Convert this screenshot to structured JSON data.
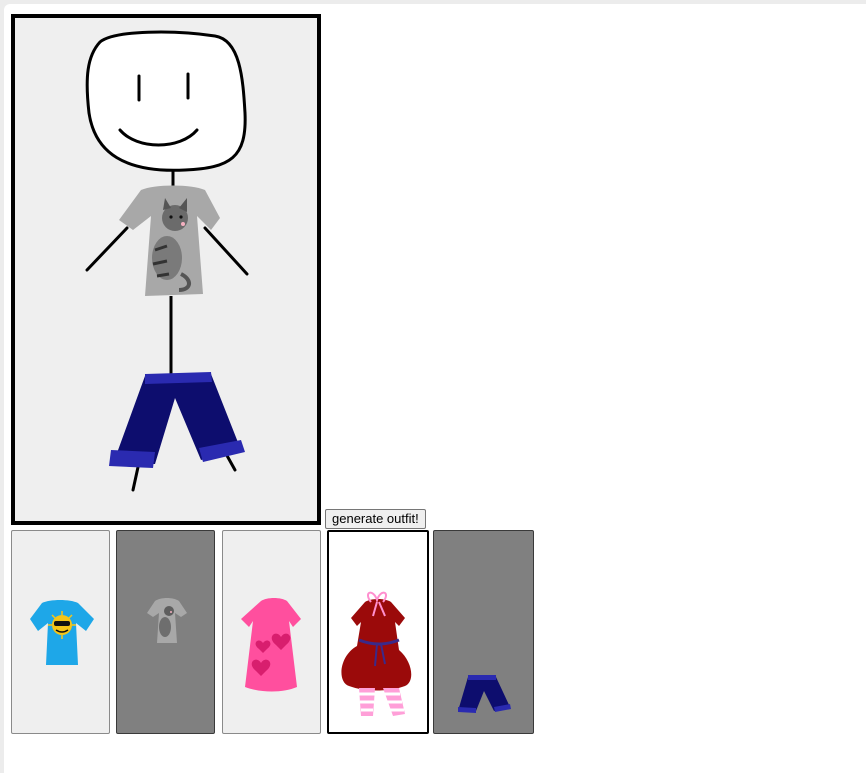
{
  "button": {
    "label": "generate outfit!"
  },
  "stage": {
    "figure": "stick-figure",
    "worn": [
      "cat-shirt",
      "blue-shorts"
    ]
  },
  "wardrobe": [
    {
      "name": "sun-shirt",
      "highlighted": false
    },
    {
      "name": "cat-shirt",
      "highlighted": false
    },
    {
      "name": "pink-heart-dress",
      "highlighted": false
    },
    {
      "name": "red-dress-striped-leggings",
      "highlighted": true
    },
    {
      "name": "blue-shorts",
      "highlighted": false
    }
  ],
  "colors": {
    "stage_bg": "#efefef",
    "selected_tile_bg": "#808080",
    "shorts": "#0d0d6e",
    "shorts_cuff": "#2a2ab0",
    "sun_shirt": "#1ea7e8",
    "pink_dress": "#ff4f9e",
    "red_dress": "#9b0a0a"
  }
}
